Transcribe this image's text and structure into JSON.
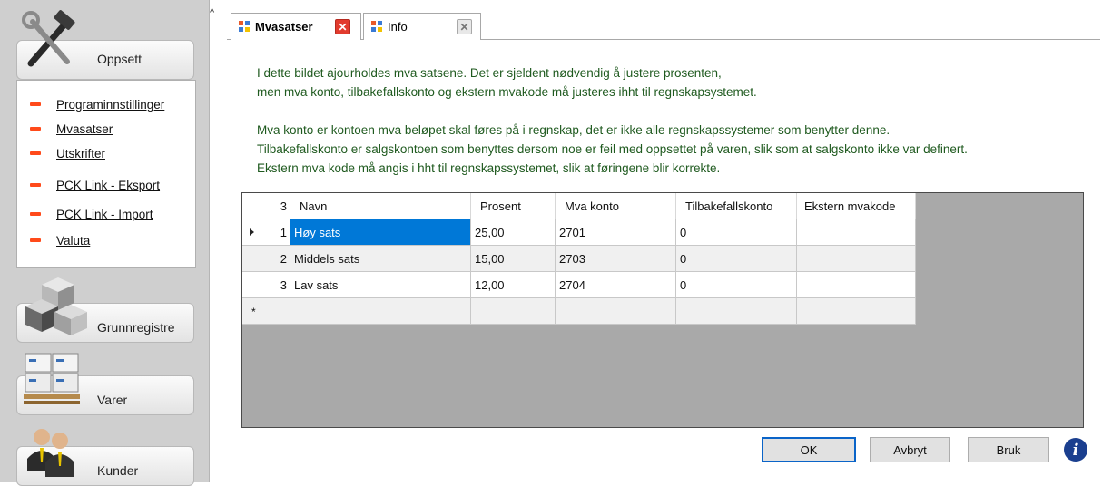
{
  "sidebar": {
    "groups": {
      "oppsett": "Oppsett",
      "grunnregistre": "Grunnregistre",
      "varer": "Varer",
      "kunder": "Kunder"
    },
    "menu_items": [
      "Programinnstillinger",
      "Mvasatser",
      "Utskrifter",
      "PCK Link - Eksport",
      "PCK Link - Import",
      "Valuta"
    ]
  },
  "tabs": [
    {
      "label": "Mvasatser",
      "active": true
    },
    {
      "label": "Info",
      "active": false
    }
  ],
  "description": {
    "line1": "I dette bildet ajourholdes mva satsene. Det er sjeldent nødvendig å justere prosenten,",
    "line2": "men mva konto, tilbakefallskonto og ekstern mvakode må justeres ihht til regnskapsystemet.",
    "line3": "Mva konto er kontoen mva beløpet skal føres på i regnskap, det er ikke alle regnskapssystemer som benytter denne.",
    "line4": "Tilbakefallskonto er salgskontoen som benyttes dersom noe er feil med oppsettet på varen, slik som at salgskonto ikke var definert.",
    "line5": "Ekstern mva kode må angis i hht til regnskapssystemet, slik at føringene blir korrekte."
  },
  "grid": {
    "row_count": "3",
    "columns": [
      "Navn",
      "Prosent",
      "Mva konto",
      "Tilbakefallskonto",
      "Ekstern mvakode"
    ],
    "rows": [
      {
        "num": "1",
        "navn": "Høy sats",
        "prosent": "25,00",
        "mva_konto": "2701",
        "tilbakefall": "0",
        "ekstern": ""
      },
      {
        "num": "2",
        "navn": "Middels sats",
        "prosent": "15,00",
        "mva_konto": "2703",
        "tilbakefall": "0",
        "ekstern": ""
      },
      {
        "num": "3",
        "navn": "Lav sats",
        "prosent": "12,00",
        "mva_konto": "2704",
        "tilbakefall": "0",
        "ekstern": ""
      }
    ],
    "new_row_marker": "*"
  },
  "buttons": {
    "ok": "OK",
    "avbryt": "Avbryt",
    "bruk": "Bruk",
    "info": "i"
  },
  "colors": {
    "accent_orange": "#ff4a1a",
    "selection_blue": "#0078d7",
    "description_green": "#1f5a1f"
  }
}
